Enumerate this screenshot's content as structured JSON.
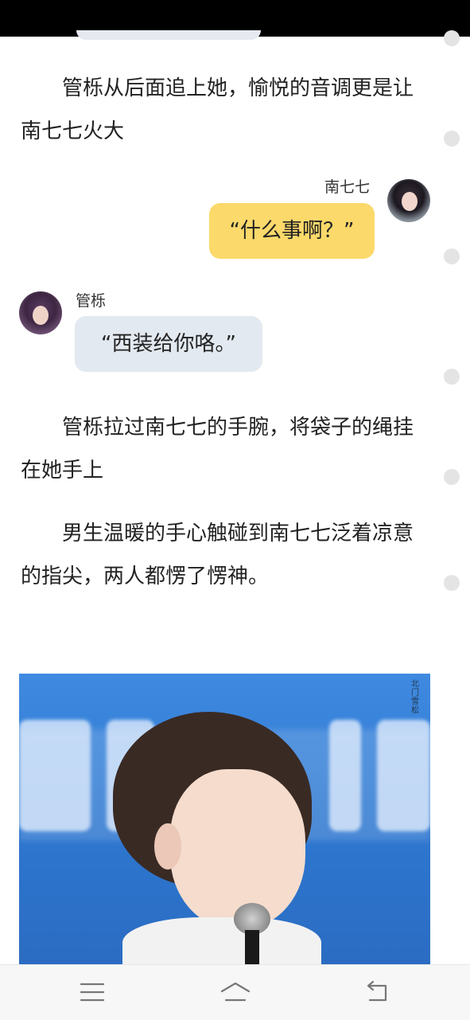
{
  "story": {
    "paragraphs": [
      "管栎从后面追上她，愉悦的音调更是让南七七火大",
      "管栎拉过南七七的手腕，将袋子的绳挂在她手上",
      "男生温暖的手心触碰到南七七泛着凉意的指尖，两人都愣了愣神。"
    ],
    "dialogue": [
      {
        "speaker": "南七七",
        "text": "“什么事啊？”",
        "side": "right",
        "bubble_color": "#fcd96b"
      },
      {
        "speaker": "管栎",
        "text": "“西装给你咯。”",
        "side": "left",
        "bubble_color": "#e3e9f0"
      }
    ],
    "image": {
      "watermark": "北门雪松"
    }
  },
  "navigation": {
    "buttons": [
      {
        "name": "menu",
        "icon": "menu-lines-icon"
      },
      {
        "name": "home",
        "icon": "home-icon"
      },
      {
        "name": "back",
        "icon": "back-arrow-icon"
      }
    ]
  },
  "colors": {
    "status_bar": "#000000",
    "background": "#ffffff",
    "right_bubble": "#fcd96b",
    "left_bubble": "#e3e9f0",
    "nav_bar": "#f7f7f7"
  }
}
